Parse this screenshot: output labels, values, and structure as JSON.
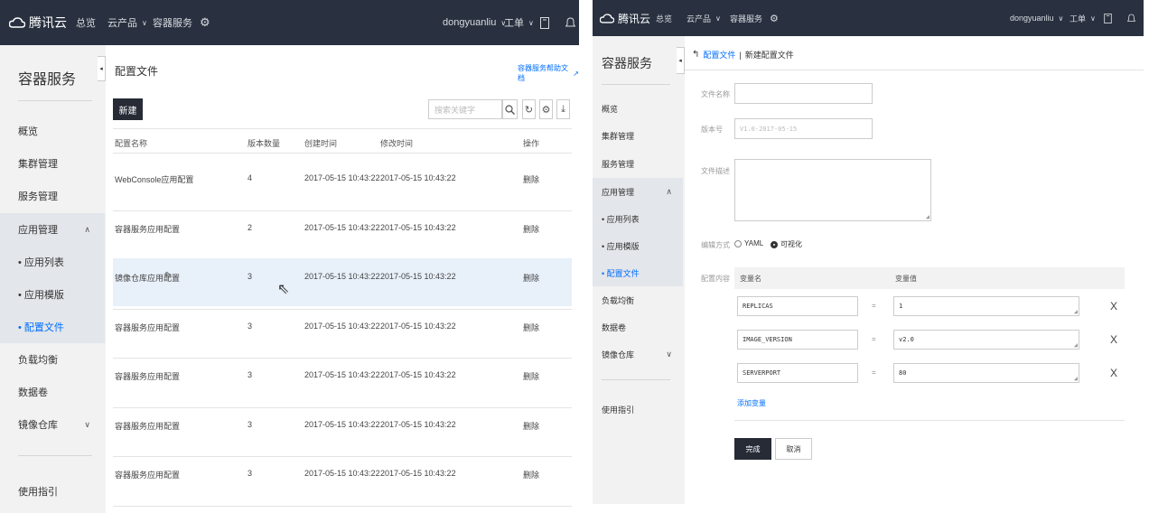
{
  "left": {
    "topbar": {
      "brand": "腾讯云",
      "nav_overview": "总览",
      "nav_products": "云产品",
      "nav_service": "容器服务",
      "user": "dongyuanliu",
      "tickets": "工单"
    },
    "sidebar": {
      "title": "容器服务",
      "items": [
        "概览",
        "集群管理",
        "服务管理",
        "应用管理",
        "• 应用列表",
        "• 应用模版",
        "• 配置文件",
        "负载均衡",
        "数据卷",
        "镜像仓库",
        "使用指引"
      ]
    },
    "main": {
      "title": "配置文件",
      "help_link": "容器服务帮助文档",
      "new_button": "新建",
      "search_placeholder": "搜索关键字",
      "columns": [
        "配置名称",
        "版本数量",
        "创建时间",
        "修改时间",
        "操作"
      ],
      "rows": [
        {
          "name": "WebConsole应用配置",
          "versions": "4",
          "created": "2017-05-15 10:43:22",
          "modified": "2017-05-15 10:43:22",
          "action": "删除"
        },
        {
          "name": "容器服务应用配置",
          "versions": "2",
          "created": "2017-05-15 10:43:22",
          "modified": "2017-05-15 10:43:22",
          "action": "删除"
        },
        {
          "name": "镜像仓库应用配置",
          "versions": "3",
          "created": "2017-05-15 10:43:22",
          "modified": "2017-05-15 10:43:22",
          "action": "删除"
        },
        {
          "name": "容器服务应用配置",
          "versions": "3",
          "created": "2017-05-15 10:43:22",
          "modified": "2017-05-15 10:43:22",
          "action": "删除"
        },
        {
          "name": "容器服务应用配置",
          "versions": "3",
          "created": "2017-05-15 10:43:22",
          "modified": "2017-05-15 10:43:22",
          "action": "删除"
        },
        {
          "name": "容器服务应用配置",
          "versions": "3",
          "created": "2017-05-15 10:43:22",
          "modified": "2017-05-15 10:43:22",
          "action": "删除"
        },
        {
          "name": "容器服务应用配置",
          "versions": "3",
          "created": "2017-05-15 10:43:22",
          "modified": "2017-05-15 10:43:22",
          "action": "删除"
        }
      ]
    }
  },
  "right": {
    "topbar": {
      "brand": "腾讯云",
      "nav_overview": "总览",
      "nav_products": "云产品",
      "nav_service": "容器服务",
      "user": "dongyuanliu",
      "tickets": "工单"
    },
    "sidebar": {
      "title": "容器服务",
      "items": [
        "概览",
        "集群管理",
        "服务管理",
        "应用管理",
        "• 应用列表",
        "• 应用模版",
        "• 配置文件",
        "负载均衡",
        "数据卷",
        "镜像仓库",
        "使用指引"
      ]
    },
    "main": {
      "breadcrumb_back": "配置文件",
      "breadcrumb_sep": "|",
      "breadcrumb_current": "新建配置文件",
      "label_name": "文件名称",
      "label_version": "版本号",
      "version_placeholder": "V1.0-2017-05-15",
      "label_desc": "文件描述",
      "label_mode": "编辑方式",
      "mode_yaml": "YAML",
      "mode_visual": "可视化",
      "label_content": "配置内容",
      "col_var_name": "变量名",
      "col_var_value": "变量值",
      "vars": [
        {
          "name": "REPLICAS",
          "eq": "=",
          "value": "1",
          "remove": "X"
        },
        {
          "name": "IMAGE_VERSION",
          "eq": "=",
          "value": "v2.0",
          "remove": "X"
        },
        {
          "name": "SERVERPORT",
          "eq": "=",
          "value": "80",
          "remove": "X"
        }
      ],
      "add_var": "添加变量",
      "submit": "完成",
      "cancel": "取消"
    }
  },
  "colors": {
    "topbar": "#293140",
    "accent": "#006eff",
    "sidebar_bg": "#f2f2f2",
    "dark_button": "#262b36"
  }
}
